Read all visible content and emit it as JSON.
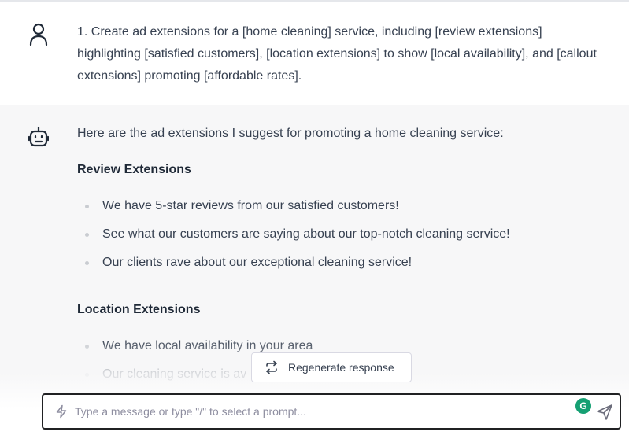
{
  "user_message": {
    "text": "1. Create ad extensions for a [home cleaning] service, including [review extensions] highlighting [satisfied customers], [location extensions] to show [local availability], and [callout extensions] promoting [affordable rates]."
  },
  "bot_message": {
    "intro": "Here are the ad extensions I suggest for promoting a home cleaning service:",
    "sections": [
      {
        "heading": "Review Extensions",
        "items": [
          "We have 5-star reviews from our satisfied customers!",
          "See what our customers are saying about our top-notch cleaning service!",
          "Our clients rave about our exceptional cleaning service!"
        ]
      },
      {
        "heading": "Location Extensions",
        "items": [
          "We have local availability in your area",
          "Our cleaning service is av"
        ]
      }
    ]
  },
  "regenerate": {
    "label": "Regenerate response"
  },
  "composer": {
    "placeholder": "Type a message or type \"/\" to select a prompt...",
    "value": ""
  },
  "colors": {
    "bot_bg": "#f7f7f8",
    "text": "#374151",
    "grammarly": "#15a073",
    "input_border": "#202123"
  }
}
